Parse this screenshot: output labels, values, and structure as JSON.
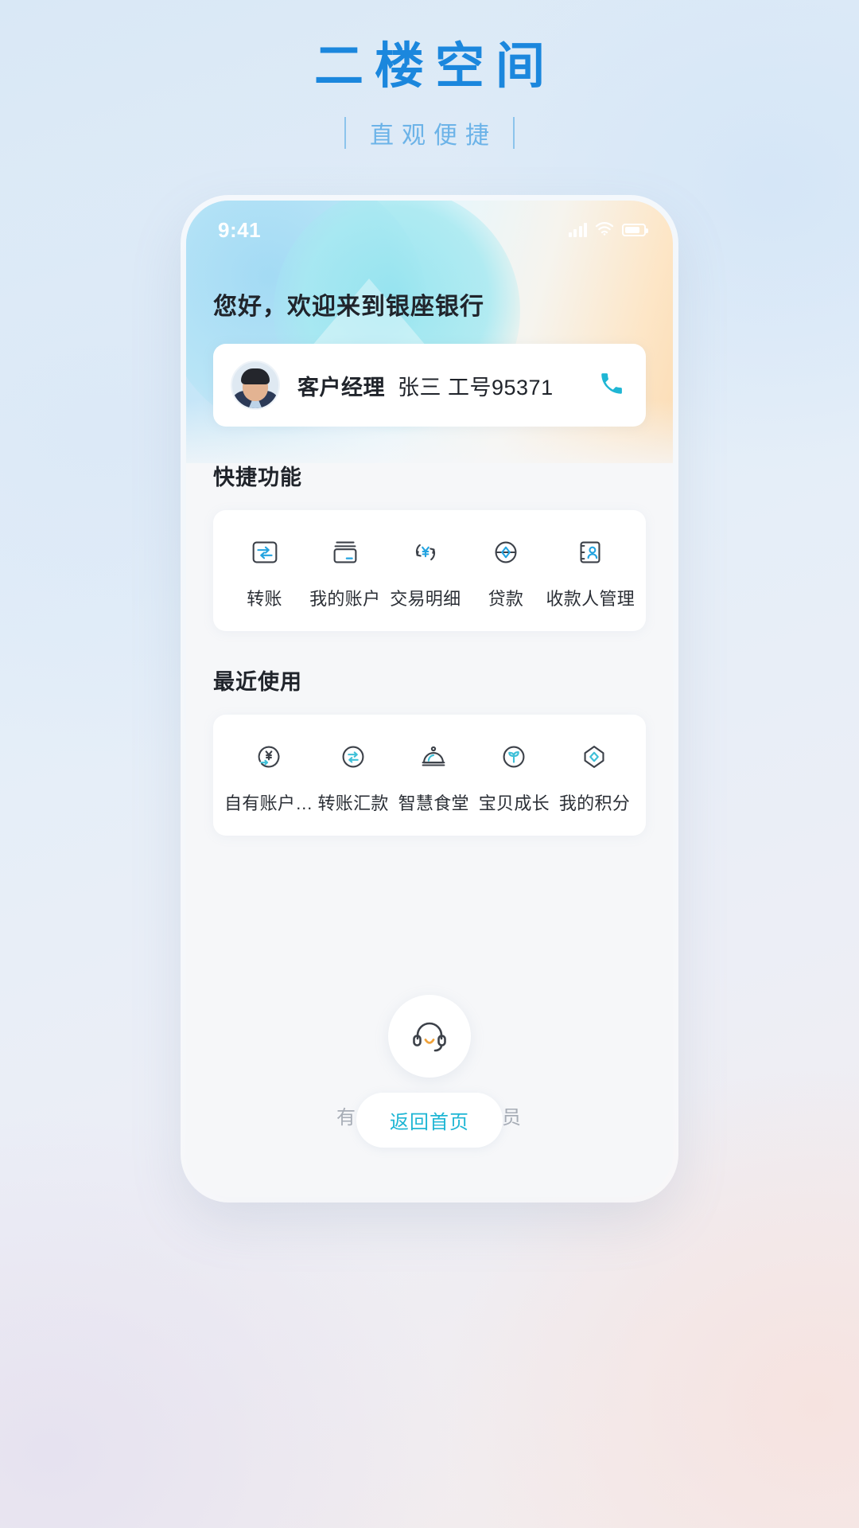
{
  "header": {
    "title": "二楼空间",
    "subtitle": "直观便捷"
  },
  "phone": {
    "status_bar": {
      "time": "9:41",
      "signal_icon": "signal-bars-icon",
      "wifi_icon": "wifi-icon",
      "battery_icon": "battery-icon"
    },
    "greeting": "您好，欢迎来到银座银行",
    "manager_card": {
      "avatar_icon": "manager-avatar",
      "role": "客户经理",
      "name_and_id": "张三 工号95371",
      "call_icon": "phone-icon"
    },
    "quick": {
      "title": "快捷功能",
      "items": [
        {
          "label": "转账",
          "icon": "transfer-icon"
        },
        {
          "label": "我的账户",
          "icon": "card-icon"
        },
        {
          "label": "交易明细",
          "icon": "yuan-refresh-icon"
        },
        {
          "label": "贷款",
          "icon": "loan-circle-icon"
        },
        {
          "label": "收款人管理",
          "icon": "payee-contact-icon"
        }
      ]
    },
    "recent": {
      "title": "最近使用",
      "items": [
        {
          "label": "自有账户…",
          "icon": "own-account-yuan-icon"
        },
        {
          "label": "转账汇款",
          "icon": "remittance-icon"
        },
        {
          "label": "智慧食堂",
          "icon": "canteen-cloche-icon"
        },
        {
          "label": "宝贝成长",
          "icon": "sprout-icon"
        },
        {
          "label": "我的积分",
          "icon": "points-gem-icon"
        }
      ]
    },
    "service": {
      "icon": "headset-icon",
      "text": "有问题，问视频柜员"
    },
    "home_button": "返回首页"
  },
  "colors": {
    "brand_blue": "#1b87dd",
    "sub_blue": "#6cb3e8",
    "accent_cyan": "#1fb6d4",
    "icon_dark": "#3c4149",
    "text_dark": "#20242b",
    "muted": "#a7adb6"
  }
}
